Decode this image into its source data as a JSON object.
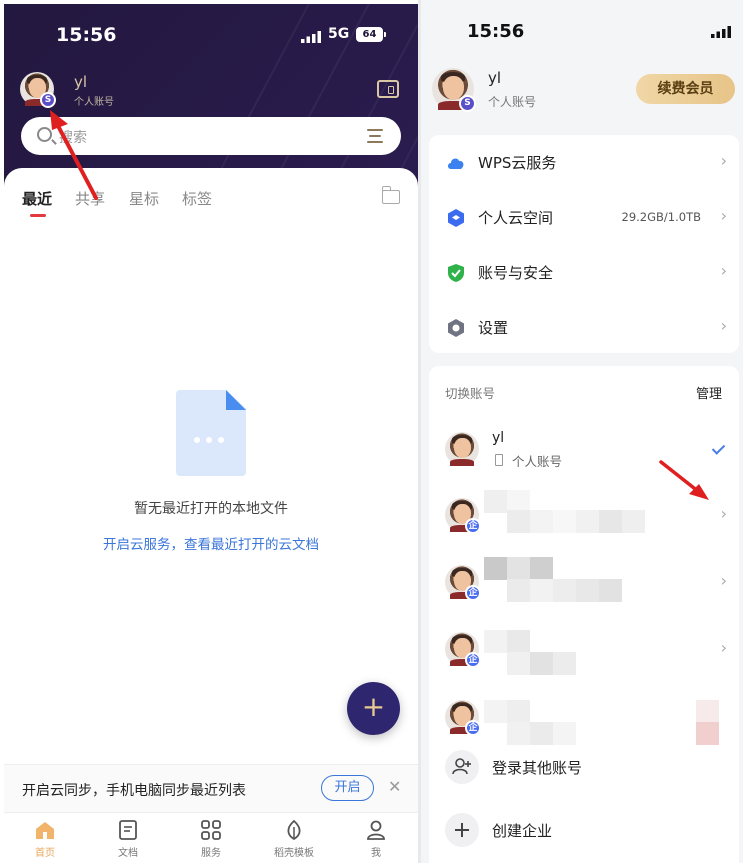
{
  "left_screen": {
    "status_bar": {
      "time": "15:56",
      "network": "5G",
      "battery": "64"
    },
    "profile": {
      "name": "yl",
      "account_type": "个人账号",
      "badge": "S"
    },
    "search": {
      "placeholder": "搜索"
    },
    "tabs": [
      {
        "label": "最近",
        "active": true
      },
      {
        "label": "共享",
        "active": false
      },
      {
        "label": "星标",
        "active": false
      },
      {
        "label": "标签",
        "active": false
      }
    ],
    "empty_state": {
      "message": "暂无最近打开的本地文件",
      "link": "开启云服务，查看最近打开的云文档"
    },
    "fab_label": "+",
    "sync_banner": {
      "text": "开启云同步，手机电脑同步最近列表",
      "button": "开启",
      "close": "✕"
    },
    "tabbar": [
      {
        "label": "首页",
        "icon": "home-icon",
        "active": true
      },
      {
        "label": "文档",
        "icon": "document-icon",
        "active": false
      },
      {
        "label": "服务",
        "icon": "grid-icon",
        "active": false
      },
      {
        "label": "稻壳模板",
        "icon": "leaf-icon",
        "active": false
      },
      {
        "label": "我",
        "icon": "person-icon",
        "active": false
      }
    ],
    "colors": {
      "header_bg": "#23183f",
      "accent_gold": "#d9c6a5",
      "active_tab_underline": "#e4393c",
      "link_blue": "#3b76d9",
      "fab_bg": "#2f2670"
    }
  },
  "right_screen": {
    "status_bar": {
      "time": "15:56"
    },
    "profile": {
      "name": "yl",
      "account_type": "个人账号",
      "badge": "S"
    },
    "renew_button": "续费会员",
    "menu": [
      {
        "label": "WPS云服务",
        "icon": "cloud-icon",
        "value": ""
      },
      {
        "label": "个人云空间",
        "icon": "cube-icon",
        "value": "29.2GB/1.0TB"
      },
      {
        "label": "账号与安全",
        "icon": "shield-icon",
        "value": ""
      },
      {
        "label": "设置",
        "icon": "gear-icon",
        "value": ""
      }
    ],
    "accounts_section": {
      "title": "切换账号",
      "manage": "管理",
      "current": {
        "name": "yl",
        "type": "个人账号"
      },
      "others_badge": "企",
      "actions": [
        {
          "label": "登录其他账号",
          "icon": "add-user-icon"
        },
        {
          "label": "创建企业",
          "icon": "plus-icon"
        }
      ]
    },
    "colors": {
      "renew_gold": "#e7c488",
      "check_blue": "#4a7de8",
      "annotation_arrow": "#e02020"
    }
  }
}
